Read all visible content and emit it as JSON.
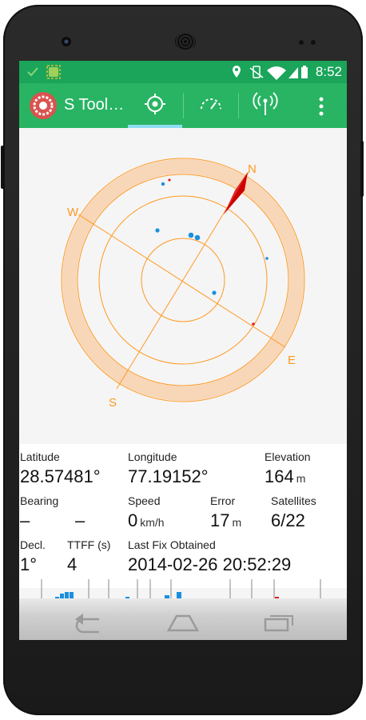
{
  "status_bar": {
    "time": "8:52"
  },
  "app_bar": {
    "title": "S Tool…",
    "tabs": [
      "location",
      "speedometer",
      "signal"
    ],
    "active_tab": 0
  },
  "radar": {
    "directions": {
      "n": "N",
      "e": "E",
      "s": "S",
      "w": "W"
    },
    "heading_marker_color": "#cc0000",
    "accent_color": "#ff9922"
  },
  "stats": {
    "latitude": {
      "label": "Latitude",
      "value": "28.57481°"
    },
    "longitude": {
      "label": "Longitude",
      "value": "77.19152°"
    },
    "elevation": {
      "label": "Elevation",
      "value": "164",
      "unit": "m"
    },
    "bearing": {
      "label": "Bearing",
      "value": "–",
      "value2": "–"
    },
    "speed": {
      "label": "Speed",
      "value": "0",
      "unit": "km/h"
    },
    "error": {
      "label": "Error",
      "value": "17",
      "unit": "m"
    },
    "satellites": {
      "label": "Satellites",
      "value": "6/22"
    },
    "decl": {
      "label": "Decl.",
      "value": "1°"
    },
    "ttff": {
      "label": "TTFF (s)",
      "value": "4"
    },
    "last_fix": {
      "label": "Last Fix Obtained",
      "value": "2014-02-26 20:52:29"
    }
  },
  "signal_bars": {
    "colors": {
      "used": "#1a8fe0",
      "unused": "#dd2222"
    }
  }
}
